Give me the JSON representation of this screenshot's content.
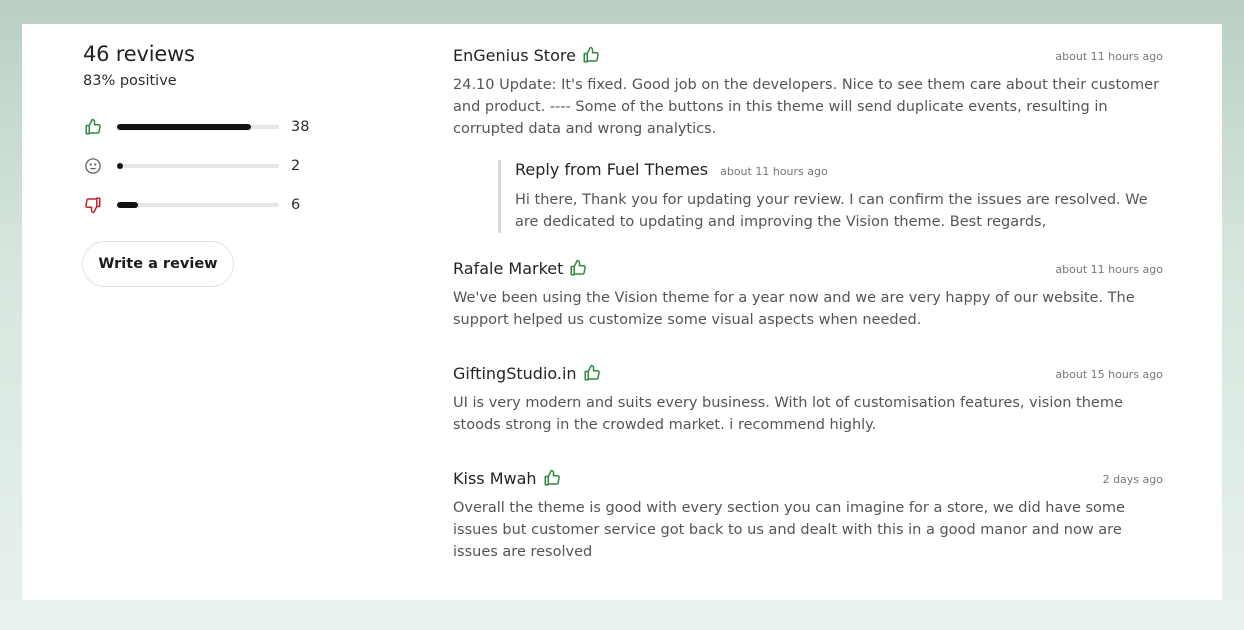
{
  "summary": {
    "title": "46 reviews",
    "positive_text": "83% positive",
    "ratings": [
      {
        "type": "positive",
        "icon": "thumbs-up-icon",
        "count": "38",
        "fraction": 0.83,
        "color": "#2e8b3e"
      },
      {
        "type": "neutral",
        "icon": "neutral-face-icon",
        "count": "2",
        "fraction": 0.04,
        "color": "#666666"
      },
      {
        "type": "negative",
        "icon": "thumbs-down-icon",
        "count": "6",
        "fraction": 0.13,
        "color": "#c0262d"
      }
    ],
    "write_button": "Write a review"
  },
  "reviews": [
    {
      "author": "EnGenius Store",
      "time": "about 11 hours ago",
      "body": "24.10 Update: It's fixed. Good job on the developers. Nice to see them care about their customer and product. ---- Some of the buttons in this theme will send duplicate events, resulting in corrupted data and wrong analytics.",
      "reply": {
        "title": "Reply from Fuel Themes",
        "time": "about 11 hours ago",
        "body": "Hi there, Thank you for updating your review. I can confirm the issues are resolved. We are dedicated to updating and improving the Vision theme. Best regards,"
      }
    },
    {
      "author": "Rafale Market",
      "time": "about 11 hours ago",
      "body": "We've been using the Vision theme for a year now and we are very happy of our website. The support helped us customize some visual aspects when needed."
    },
    {
      "author": "GiftingStudio.in",
      "time": "about 15 hours ago",
      "body": "UI is very modern and suits every business. With lot of customisation features, vision theme stoods strong in the crowded market. i recommend highly."
    },
    {
      "author": "Kiss Mwah",
      "time": "2 days ago",
      "body": "Overall the theme is good with every section you can imagine for a store, we did have some issues but customer service got back to us and dealt with this in a good manor and now are issues are resolved"
    }
  ],
  "colors": {
    "positive": "#2e8b3e",
    "negative": "#c0262d"
  }
}
